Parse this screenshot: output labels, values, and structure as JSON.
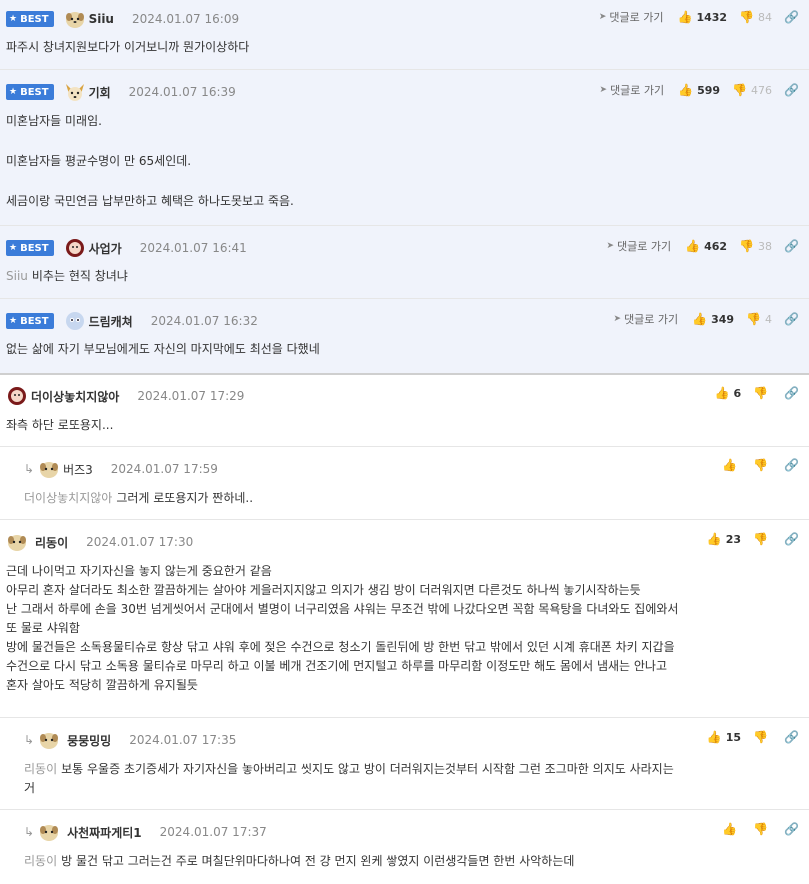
{
  "labels": {
    "best": "BEST",
    "goto_reply": "댓글로 가기"
  },
  "comments": [
    {
      "nick": "Siiu",
      "date": "2024.01.07 16:09",
      "up": "1432",
      "down": "84",
      "lines": [
        "파주시 창녀지원보다가 이거보니까 뭔가이상하다"
      ]
    },
    {
      "nick": "기회",
      "date": "2024.01.07 16:39",
      "up": "599",
      "down": "476",
      "lines": [
        "미혼남자들 미래임.",
        "",
        "미혼남자들 평균수명이 만 65세인데.",
        "",
        "세금이랑 국민연금 납부만하고 혜택은 하나도못보고 죽음."
      ]
    },
    {
      "nick": "사업가",
      "date": "2024.01.07 16:41",
      "up": "462",
      "down": "38",
      "mention": "Siiu",
      "text": "비추는 현직 창녀냐"
    },
    {
      "nick": "드림캐쳐",
      "date": "2024.01.07 16:32",
      "up": "349",
      "down": "4",
      "lines": [
        "없는 삶에 자기 부모님에게도 자신의 마지막에도 최선을 다했네"
      ]
    },
    {
      "nick": "더이상놓치지않아",
      "date": "2024.01.07 17:29",
      "up": "6",
      "lines": [
        "좌측 하단 로또용지..."
      ]
    },
    {
      "nick": "버즈3",
      "date": "2024.01.07 17:59",
      "mention": "더이상놓치지않아",
      "text": "그러게 로또용지가 짠하네.."
    },
    {
      "nick": "리동이",
      "date": "2024.01.07 17:30",
      "up": "23",
      "lines": [
        "근데 나이먹고 자기자신을 놓지 않는게 중요한거 같음",
        "아무리 혼자 살더라도 최소한 깔끔하게는 살아야 게을러지지않고 의지가 생김 방이 더러워지면 다른것도 하나씩 놓기시작하는듯",
        "난 그래서 하루에 손을 30번 넘게씻어서 군대에서 별명이 너구리였음 샤워는 무조건 밖에 나갔다오면 꼭함 목욕탕을 다녀와도 집에와서",
        "또 물로 샤워함",
        "방에 물건들은 소독용물티슈로 항상 닦고 샤워 후에 젖은 수건으로 청소기 돌린뒤에 방 한번 닦고 밖에서 있던 시계 휴대폰 차키 지갑을",
        "수건으로 다시 닦고 소독용 물티슈로 마무리 하고 이불 베개 건조기에 먼지털고 하루를 마무리함 이정도만 해도 몸에서 냄새는 안나고",
        "혼자 살아도 적당히 깔끔하게 유지될듯"
      ]
    },
    {
      "nick": "뭉뭉밍밍",
      "date": "2024.01.07 17:35",
      "up": "15",
      "mention": "리동이",
      "text": "보통 우울증 초기증세가 자기자신을 놓아버리고 씻지도 않고 방이 더러워지는것부터 시작함 그런 조그마한 의지도 사라지는",
      "text2": "거"
    },
    {
      "nick": "사천짜파게티1",
      "date": "2024.01.07 17:37",
      "mention": "리동이",
      "text": "방 물건 닦고 그러는건 주로 며칠단위마다하나여 전 걍 먼지 왼케 쌓였지 이런생각들면 한번 사악하는데"
    }
  ]
}
